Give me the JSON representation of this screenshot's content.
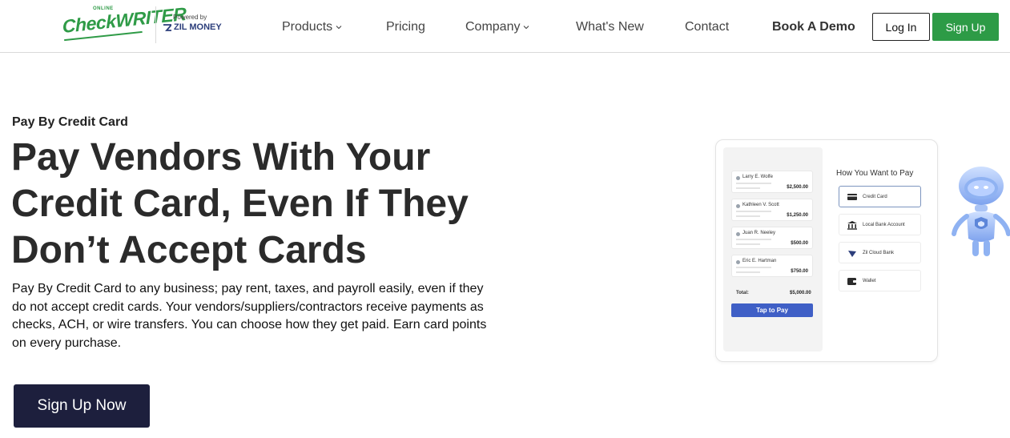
{
  "header": {
    "logo": {
      "online": "ONLINE",
      "brand": "CheckWRITER"
    },
    "powered_by": "Powered by",
    "partner": "ZIL MONEY",
    "nav": [
      {
        "label": "Products",
        "dropdown": true
      },
      {
        "label": "Pricing",
        "dropdown": false
      },
      {
        "label": "Company",
        "dropdown": true
      },
      {
        "label": "What's New",
        "dropdown": false
      },
      {
        "label": "Contact",
        "dropdown": false
      },
      {
        "label": "Book A Demo",
        "dropdown": false
      }
    ],
    "login_label": "Log In",
    "signup_label": "Sign Up"
  },
  "hero": {
    "eyebrow": "Pay By Credit Card",
    "headline_lines": [
      "Pay Vendors With Your",
      "Credit Card, Even If They",
      "Don’t Accept Cards"
    ],
    "description": "Pay By Credit Card to any business; pay rent, taxes, and payroll easily, even if they do not accept credit cards. Your vendors/suppliers/contractors receive payments as checks, ACH, or wire transfers. You can choose how they get paid. Earn card points on every purchase.",
    "cta_label": "Sign Up Now"
  },
  "illustration": {
    "payees": [
      {
        "name": "Larry E. Wolfe",
        "amount": "$2,500.00"
      },
      {
        "name": "Kathleen V. Scott",
        "amount": "$1,250.00"
      },
      {
        "name": "Juan R. Neeley",
        "amount": "$500.00"
      },
      {
        "name": "Eric E. Hartman",
        "amount": "$750.00"
      }
    ],
    "total_label": "Total:",
    "total_value": "$5,000.00",
    "tap_label": "Tap to Pay",
    "options_title": "How You Want to Pay",
    "options": [
      {
        "label": "Credit Card",
        "icon": "credit-card-icon",
        "selected": true
      },
      {
        "label": "Local Bank Account",
        "icon": "bank-icon",
        "selected": false
      },
      {
        "label": "Zil Cloud Bank",
        "icon": "cloud-bank-icon",
        "selected": false
      },
      {
        "label": "Wallet",
        "icon": "wallet-icon",
        "selected": false
      }
    ]
  },
  "colors": {
    "brand_green": "#2d9b46",
    "cta_navy": "#1d1f3d",
    "accent_blue": "#3f5fc6"
  }
}
